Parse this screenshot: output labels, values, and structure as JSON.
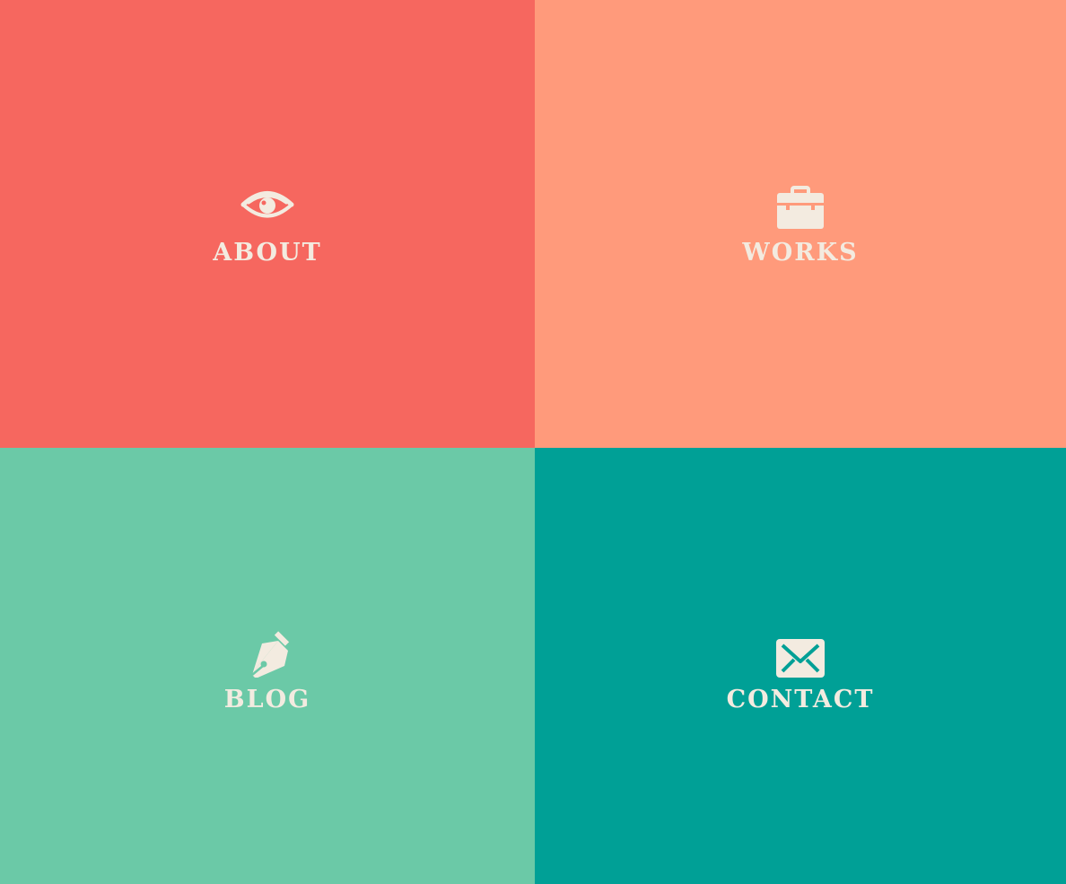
{
  "colors": {
    "about_bg": "#F6675F",
    "works_bg": "#FF9A7B",
    "blog_bg": "#6BC9A7",
    "contact_bg": "#00A096",
    "foreground": "#F3EBE0"
  },
  "tiles": [
    {
      "label": "ABOUT",
      "icon": "eye-icon"
    },
    {
      "label": "WORKS",
      "icon": "briefcase-icon"
    },
    {
      "label": "BLOG",
      "icon": "pen-nib-icon"
    },
    {
      "label": "CONTACT",
      "icon": "envelope-icon"
    }
  ]
}
